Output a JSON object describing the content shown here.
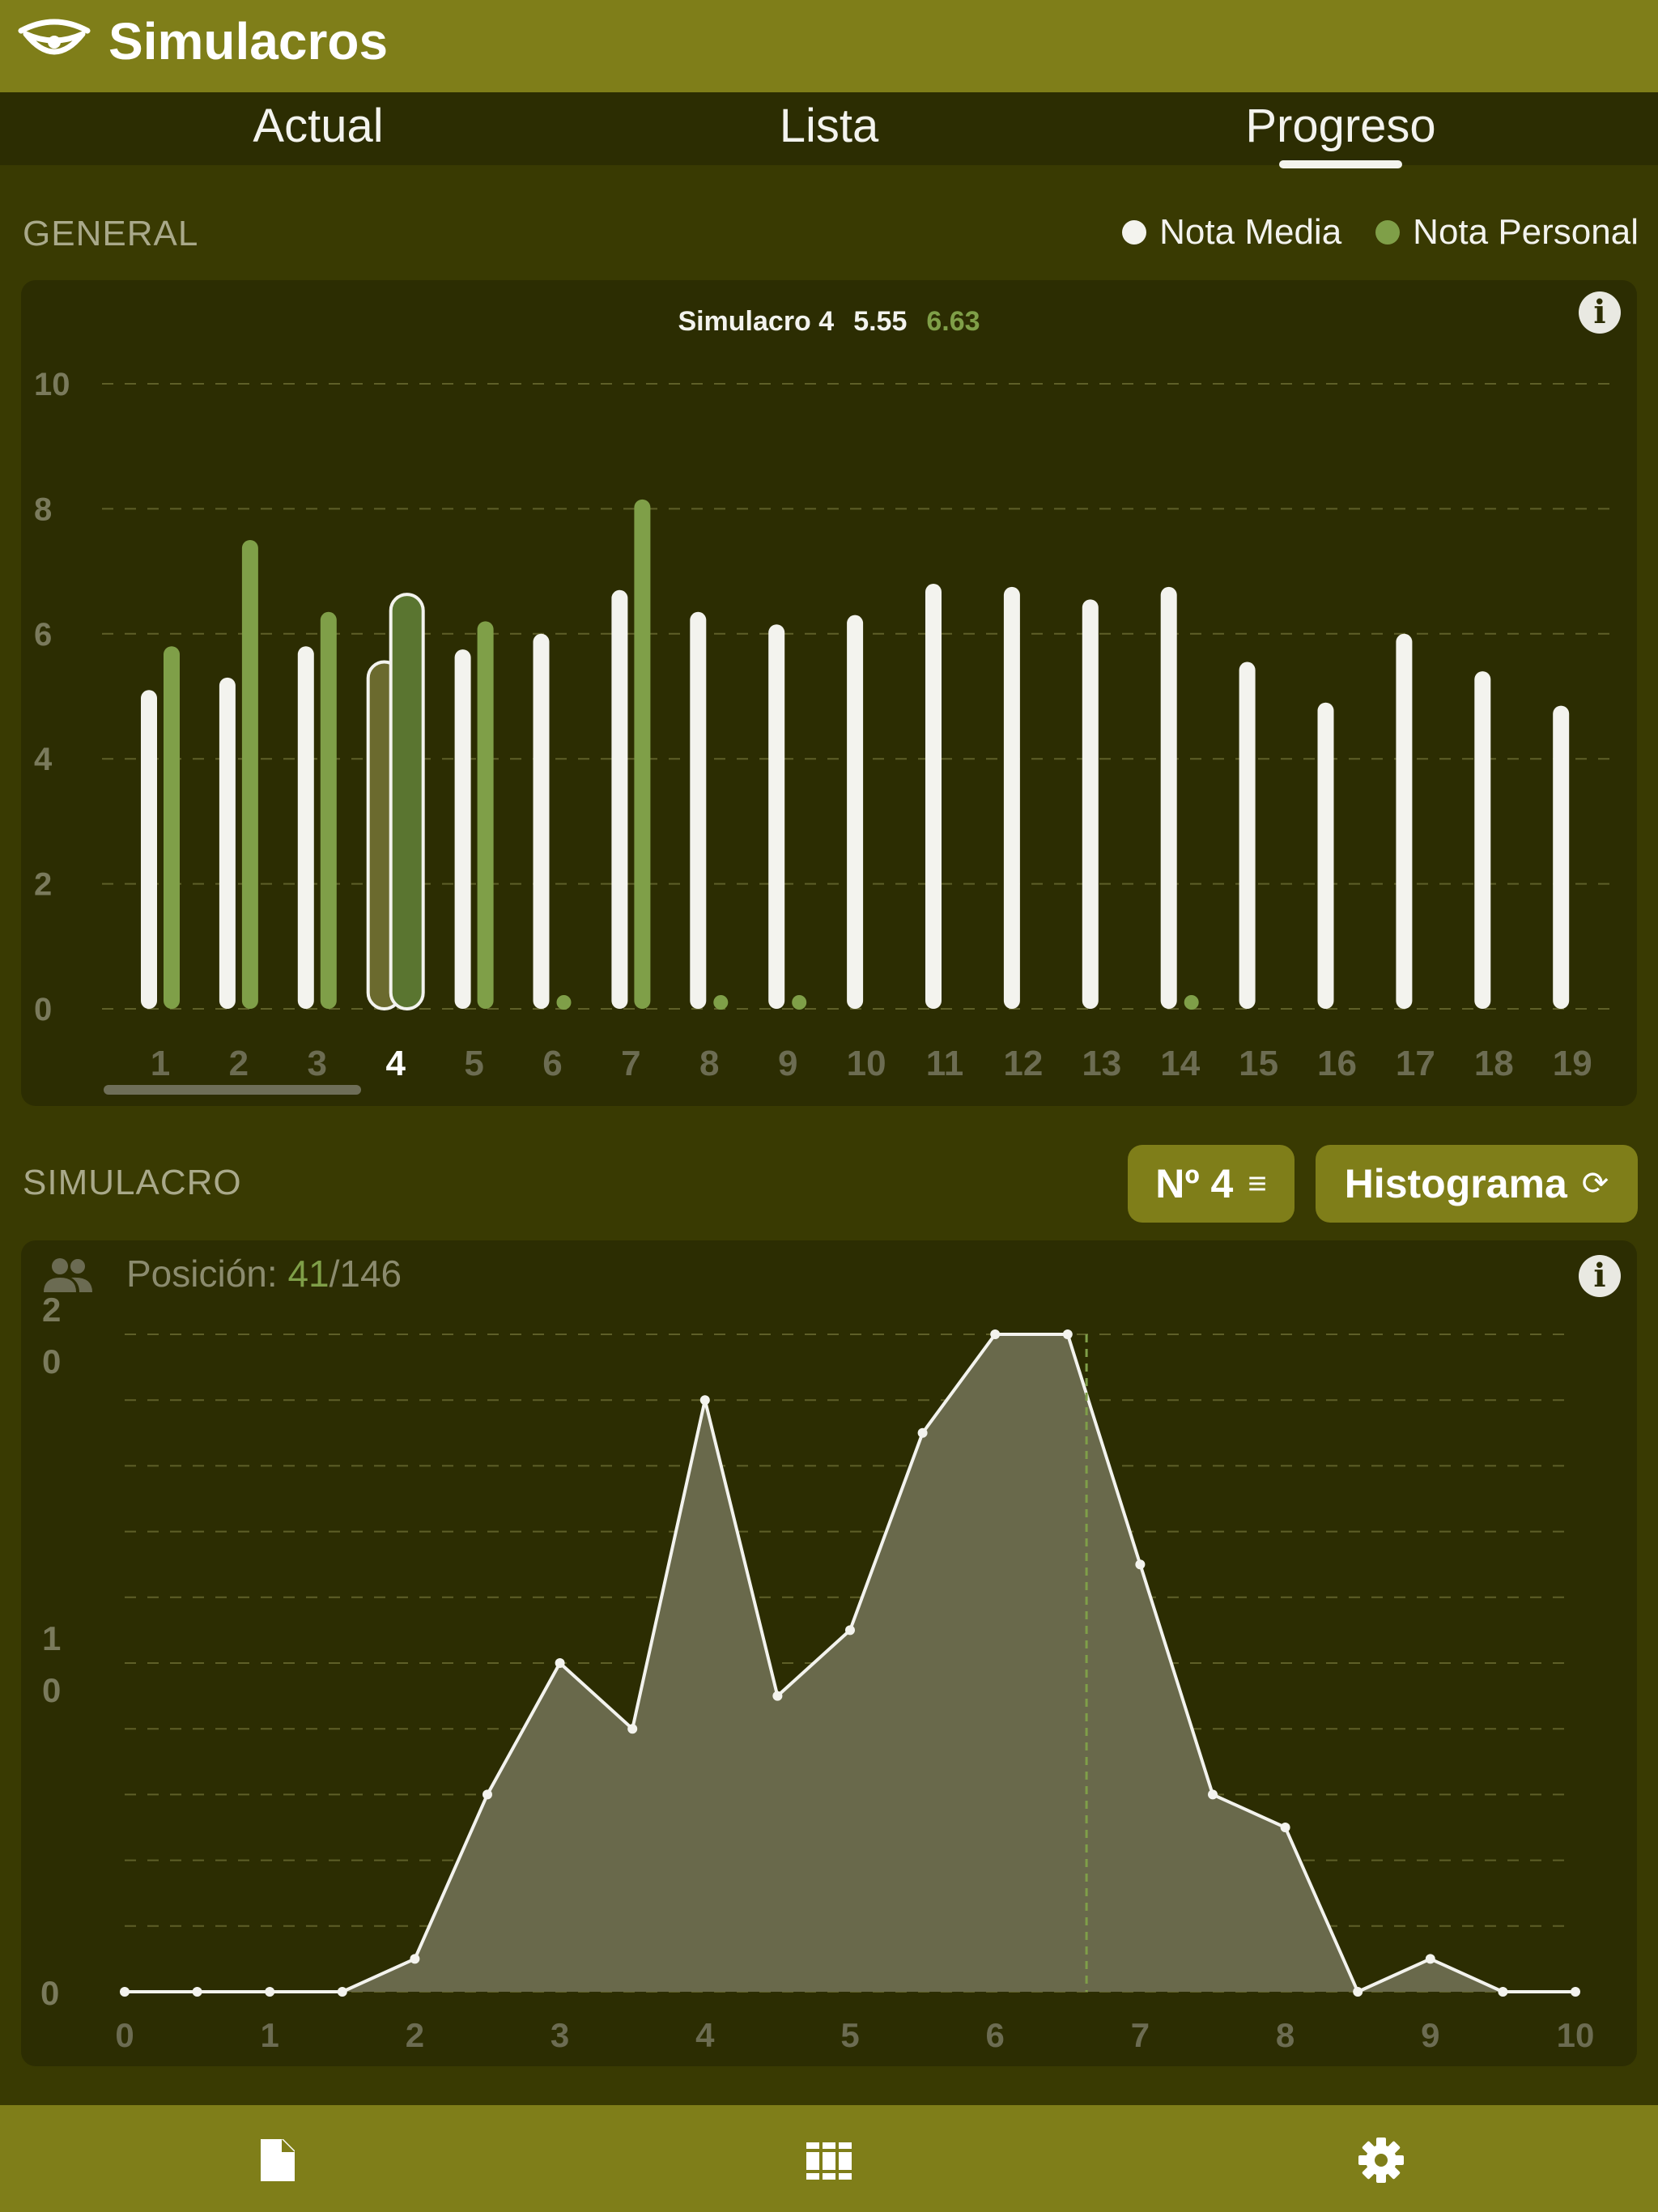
{
  "app": {
    "title": "Simulacros",
    "logo_icon": "eye-logo-icon"
  },
  "tabs": [
    {
      "label": "Actual",
      "selected": false
    },
    {
      "label": "Lista",
      "selected": false
    },
    {
      "label": "Progreso",
      "selected": true
    }
  ],
  "general": {
    "section_label": "GENERAL",
    "legend": [
      {
        "label": "Nota Media",
        "color": "#f3f3ee"
      },
      {
        "label": "Nota Personal",
        "color": "#7f9f48"
      }
    ],
    "tooltip": {
      "title": "Simulacro 4",
      "media": "5.55",
      "personal": "6.63"
    },
    "info_icon": "info-icon"
  },
  "chart_data": [
    {
      "type": "bar",
      "title": "",
      "xlabel": "",
      "ylabel": "",
      "ylim": [
        0,
        10
      ],
      "yticks": [
        0,
        2,
        4,
        6,
        8,
        10
      ],
      "grid": true,
      "legend_position": "top-right",
      "selected_category": "4",
      "categories": [
        "1",
        "2",
        "3",
        "4",
        "5",
        "6",
        "7",
        "8",
        "9",
        "10",
        "11",
        "12",
        "13",
        "14",
        "15",
        "16",
        "17",
        "18",
        "19"
      ],
      "series": [
        {
          "name": "Nota Media",
          "color": "#f3f3ee",
          "values": [
            5.1,
            5.3,
            5.8,
            5.55,
            5.75,
            6.0,
            6.7,
            6.35,
            6.15,
            6.3,
            6.8,
            6.75,
            6.55,
            6.75,
            5.55,
            4.9,
            6.0,
            5.4,
            4.85
          ]
        },
        {
          "name": "Nota Personal",
          "color": "#7f9f48",
          "values": [
            5.8,
            7.5,
            6.35,
            6.63,
            6.2,
            0,
            8.15,
            0,
            0,
            null,
            null,
            null,
            null,
            0,
            null,
            null,
            null,
            null,
            null
          ]
        }
      ]
    },
    {
      "type": "area",
      "title": "",
      "xlabel": "",
      "ylabel": "",
      "xlim": [
        0,
        10
      ],
      "ylim": [
        0,
        20
      ],
      "xticks": [
        0,
        1,
        2,
        3,
        4,
        5,
        6,
        7,
        8,
        9,
        10
      ],
      "yticks": [
        "0",
        "10",
        "20"
      ],
      "grid": true,
      "marker_x": 6.63,
      "x": [
        0,
        0.5,
        1,
        1.5,
        2,
        2.5,
        3,
        3.5,
        4,
        4.5,
        5,
        5.5,
        6,
        6.5,
        7,
        7.5,
        8,
        8.5,
        9,
        9.5,
        10
      ],
      "y": [
        0,
        0,
        0,
        0,
        1,
        6,
        10,
        8,
        18,
        9,
        11,
        17,
        20,
        20,
        13,
        6,
        5,
        0,
        1,
        0,
        0
      ]
    }
  ],
  "simulacro": {
    "section_label": "SIMULACRO",
    "number_button": {
      "label": "Nº 4",
      "icon": "menu-lines-icon"
    },
    "mode_button": {
      "label": "Histograma",
      "icon": "sync-icon"
    },
    "position_label": "Posición:",
    "position_value": "41",
    "position_total": "/146",
    "people_icon": "people-icon"
  },
  "bottom_nav": [
    {
      "icon": "document-icon"
    },
    {
      "icon": "books-icon"
    },
    {
      "icon": "gear-icon"
    }
  ]
}
